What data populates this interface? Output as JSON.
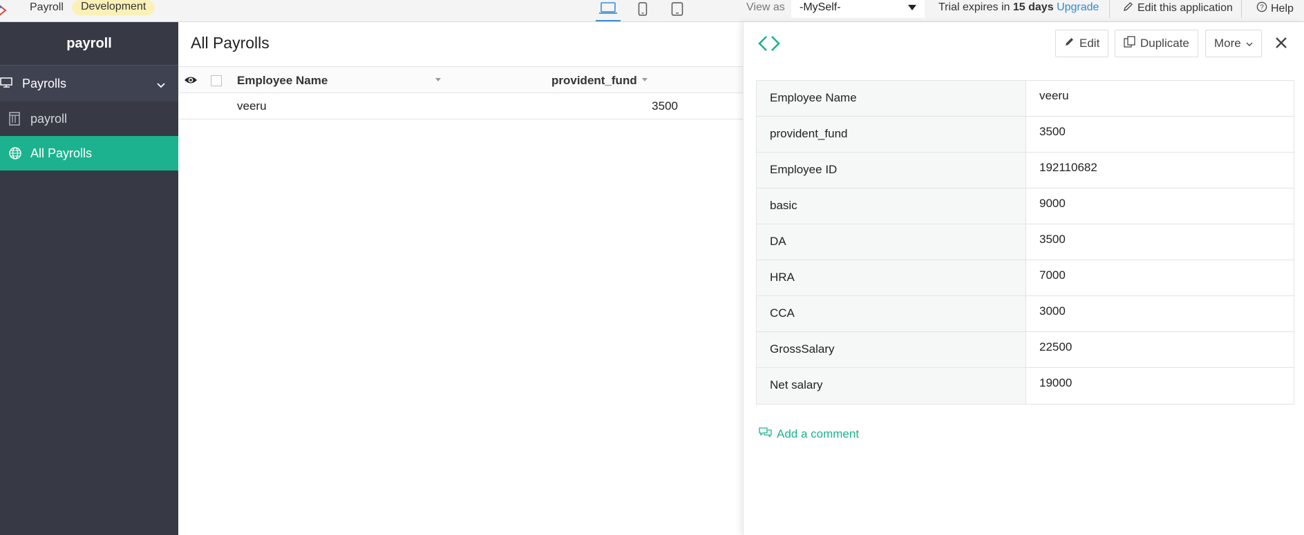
{
  "topbar": {
    "app_name": "Payroll",
    "environment": "Development",
    "view_as_label": "View as",
    "view_as_value": "-MySelf-",
    "trial_prefix": "Trial expires in",
    "trial_days": "15 days",
    "upgrade_label": "Upgrade",
    "edit_app_label": "Edit this application",
    "help_label": "Help",
    "accent_color": "#3a8bd8"
  },
  "sidebar": {
    "brand": "payroll",
    "section_label": "Payrolls",
    "items": [
      {
        "label": "payroll",
        "icon": "report-icon",
        "active": false
      },
      {
        "label": "All Payrolls",
        "icon": "globe-icon",
        "active": true
      }
    ],
    "active_color": "#1cb28f"
  },
  "list": {
    "title": "All Payrolls",
    "columns": [
      "Employee Name",
      "provident_fund"
    ],
    "rows": [
      {
        "employee_name": "veeru",
        "provident_fund": "3500"
      }
    ]
  },
  "detail": {
    "buttons": {
      "edit": "Edit",
      "duplicate": "Duplicate",
      "more": "More"
    },
    "fields": [
      {
        "label": "Employee Name",
        "value": "veeru"
      },
      {
        "label": "provident_fund",
        "value": "3500"
      },
      {
        "label": "Employee ID",
        "value": "192110682"
      },
      {
        "label": "basic",
        "value": "9000"
      },
      {
        "label": "DA",
        "value": "3500"
      },
      {
        "label": "HRA",
        "value": "7000"
      },
      {
        "label": "CCA",
        "value": "3000"
      },
      {
        "label": "GrossSalary",
        "value": "22500"
      },
      {
        "label": "Net salary",
        "value": "19000"
      }
    ],
    "add_comment_label": "Add a comment"
  }
}
